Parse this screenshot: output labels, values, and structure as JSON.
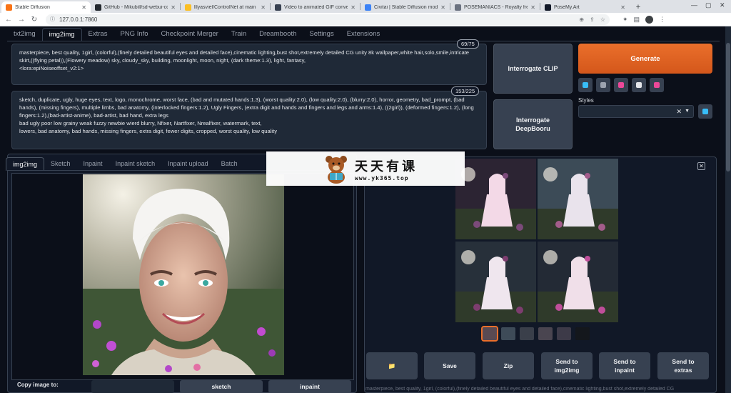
{
  "browser": {
    "tabs": [
      {
        "title": "Stable Diffusion",
        "fav": "#f97316",
        "active": true
      },
      {
        "title": "GitHub - Mikubill/sd-webui-con",
        "fav": "#24292f",
        "active": false
      },
      {
        "title": "lllyasviel/ControlNet at main",
        "fav": "#fbbf24",
        "active": false
      },
      {
        "title": "Video to animated GIF converter",
        "fav": "#374151",
        "active": false
      },
      {
        "title": "Civitai | Stable Diffusion models",
        "fav": "#3b82f6",
        "active": false
      },
      {
        "title": "POSEMANIACS - Royalty free 3d",
        "fav": "#6b7280",
        "active": false
      },
      {
        "title": "PoseMy.Art",
        "fav": "#111827",
        "active": false
      }
    ],
    "url": "127.0.0.1:7860"
  },
  "main_tabs": [
    "txt2img",
    "img2img",
    "Extras",
    "PNG Info",
    "Checkpoint Merger",
    "Train",
    "Dreambooth",
    "Settings",
    "Extensions"
  ],
  "active_main_tab": "img2img",
  "prompt": {
    "token_count": "69/75",
    "lines": [
      "masterpiece, best quality, 1girl, (colorful),(finely detailed beautiful eyes and detailed face),cinematic lighting,bust shot,extremely detailed CG unity 8k wallpaper,white hair,solo,smile,intricate",
      "skirt,((flying petal)),(Flowery meadow) sky, cloudy_sky, building, moonlight, moon, night, (dark theme:1.3), light, fantasy,",
      "<lora:epiNoiseoffset_v2:1>"
    ]
  },
  "negative_prompt": {
    "token_count": "153/225",
    "lines": [
      "sketch, duplicate, ugly, huge eyes, text, logo, monochrome, worst face, (bad and mutated hands:1.3), (worst quality:2.0), (low quality:2.0), (blurry:2.0), horror, geometry, bad_prompt, (bad",
      "hands), (missing fingers), multiple limbs, bad anatomy, (interlocked fingers:1.2), Ugly Fingers, (extra digit and hands and fingers and legs and arms:1.4), ((2girl)), (deformed fingers:1.2), (long",
      "fingers:1.2),(bad-artist-anime), bad-artist, bad hand, extra legs",
      "bad ugly poor low grainy weak fuzzy newbie wierd blurry, Nfixer, Nartfixer, Nrealfixer, watermark, text,",
      " lowers, bad anatomy, bad hands, missing fingers, extra digit, fewer digits, cropped, worst quality, low quality"
    ]
  },
  "buttons": {
    "interrogate_clip": "Interrogate CLIP",
    "interrogate_deepbooru": "Interrogate DeepBooru",
    "generate": "Generate"
  },
  "tool_icons": [
    {
      "name": "paste-icon",
      "color": "#38bdf8"
    },
    {
      "name": "trash-icon",
      "color": "#9ca3af"
    },
    {
      "name": "extra-networks-icon",
      "color": "#ec4899"
    },
    {
      "name": "clipboard-icon",
      "color": "#e5e7eb"
    },
    {
      "name": "save-style-icon",
      "color": "#ec4899"
    }
  ],
  "styles": {
    "label": "Styles",
    "clear": "✕",
    "apply_icon": "apply-style-icon"
  },
  "sub_tabs": [
    "img2img",
    "Sketch",
    "Inpaint",
    "Inpaint sketch",
    "Inpaint upload",
    "Batch"
  ],
  "active_sub_tab": "img2img",
  "copy_image": {
    "label": "Copy image to:",
    "buttons": [
      "",
      "sketch",
      "inpaint"
    ]
  },
  "output_buttons": [
    "📁",
    "Save",
    "Zip",
    "Send to img2img",
    "Send to inpaint",
    "Send to extras"
  ],
  "info_line": "masterpiece, best quality, 1girl, (colorful),(finely detailed beautiful eyes and detailed face),cinematic lighting,bust shot,extremely detailed CG",
  "watermark": {
    "cn": "天天有课",
    "url": "www.yk365.top"
  }
}
